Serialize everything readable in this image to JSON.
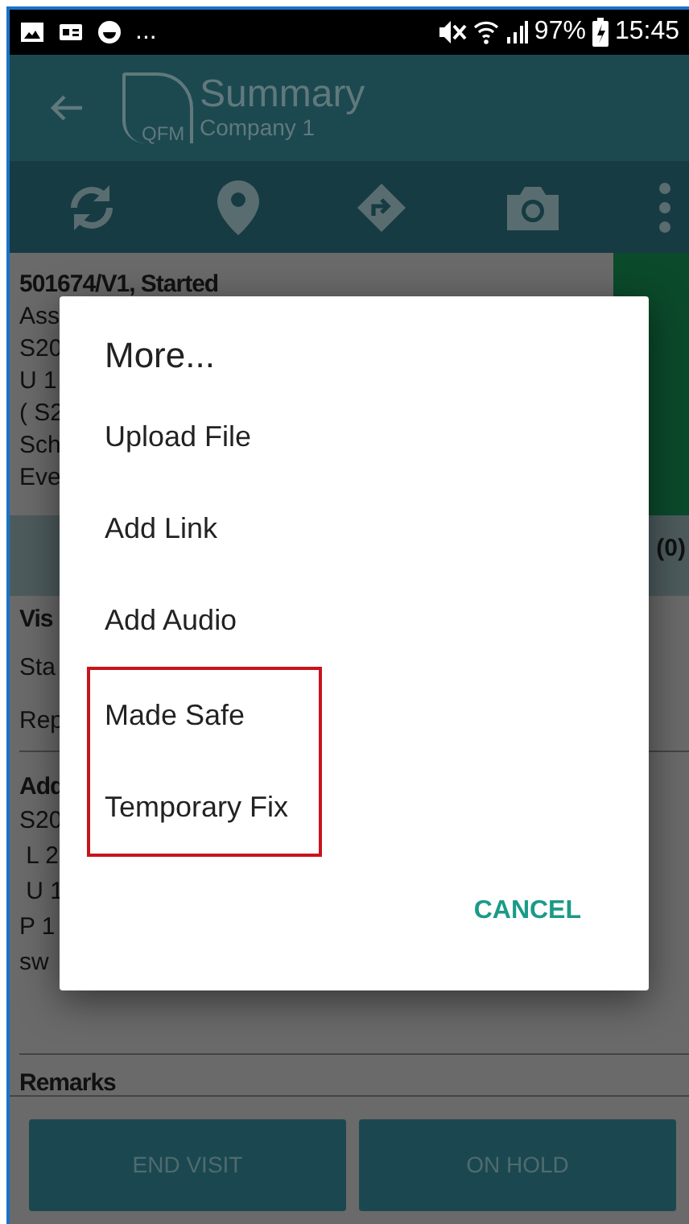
{
  "status_bar": {
    "more": "...",
    "battery": "97%",
    "time": "15:45"
  },
  "app_bar": {
    "logo_text": "QFM",
    "title": "Summary",
    "subtitle": "Company 1"
  },
  "summary": {
    "heading": "501674/V1, Started",
    "lines": [
      "Ass",
      "S20",
      "U 1",
      "( S2",
      "Sch",
      "Eve"
    ]
  },
  "tab_bar": {
    "count": "(0)"
  },
  "visit": {
    "heading": "Vis",
    "lines": [
      "Sta",
      "Rep"
    ]
  },
  "address": {
    "heading": "Add",
    "lines": [
      "S20",
      " L 2",
      " U 1",
      "P 1",
      "sw"
    ]
  },
  "remarks": {
    "heading": "Remarks"
  },
  "bottom_buttons": [
    "END VISIT",
    "ON HOLD"
  ],
  "dialog": {
    "title": "More...",
    "items": [
      {
        "label": "Upload File",
        "highlighted": false
      },
      {
        "label": "Add Link",
        "highlighted": false
      },
      {
        "label": "Add Audio",
        "highlighted": false
      },
      {
        "label": "Made Safe",
        "highlighted": true
      },
      {
        "label": "Temporary Fix",
        "highlighted": true
      }
    ],
    "cancel": "CANCEL"
  }
}
